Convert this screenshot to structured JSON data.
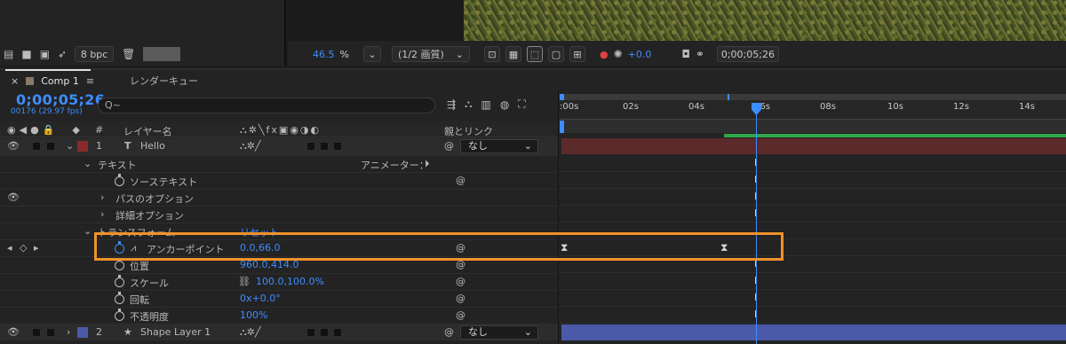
{
  "project": {
    "bpc_label": "8 bpc"
  },
  "viewer": {
    "zoom_value": "46.5",
    "zoom_unit": "%",
    "resolution": "(1/2 画質)",
    "exposure": "+0.0",
    "timecode": "0;00;05;26"
  },
  "comp": {
    "tab_label": "Comp 1",
    "render_queue_tab": "レンダーキュー",
    "timecode": "0;00;05;26",
    "frames_fps": "00176 (29.97 fps)",
    "search_placeholder": "Q~"
  },
  "columns": {
    "hash": "#",
    "layer_name": "レイヤー名",
    "parent_link": "親とリンク"
  },
  "layers": [
    {
      "index": "1",
      "type_glyph": "T",
      "name": "Hello",
      "parent": "なし",
      "color": "#8a2a2a"
    },
    {
      "index": "2",
      "type_glyph": "★",
      "name": "Shape Layer 1",
      "parent": "なし",
      "color": "#4a5aa8"
    }
  ],
  "props": {
    "text_group": "テキスト",
    "animator_label": "アニメーター：",
    "source_text": "ソーステキスト",
    "path_options": "パスのオプション",
    "more_options": "詳細オプション",
    "transform_group": "トランスフォーム",
    "reset_label": "リセット",
    "anchor_point": "アンカーポイント",
    "anchor_value": "0.0,66.0",
    "position": "位置",
    "position_value": "960.0,414.0",
    "scale": "スケール",
    "scale_value": "100.0,100.0%",
    "rotation": "回転",
    "rotation_value": "0x+0.0°",
    "opacity": "不透明度",
    "opacity_value": "100%"
  },
  "timeline": {
    "ticks": [
      ":00s",
      "02s",
      "04s",
      "06s",
      "08s",
      "10s",
      "12s",
      "14s"
    ]
  },
  "colors": {
    "accent_blue": "#3d8dff",
    "highlight_orange": "#f0922a",
    "layer1_bar": "#5c2a2a",
    "layer2_bar": "#4a5aa8",
    "work_area_green": "#2fa84a"
  }
}
